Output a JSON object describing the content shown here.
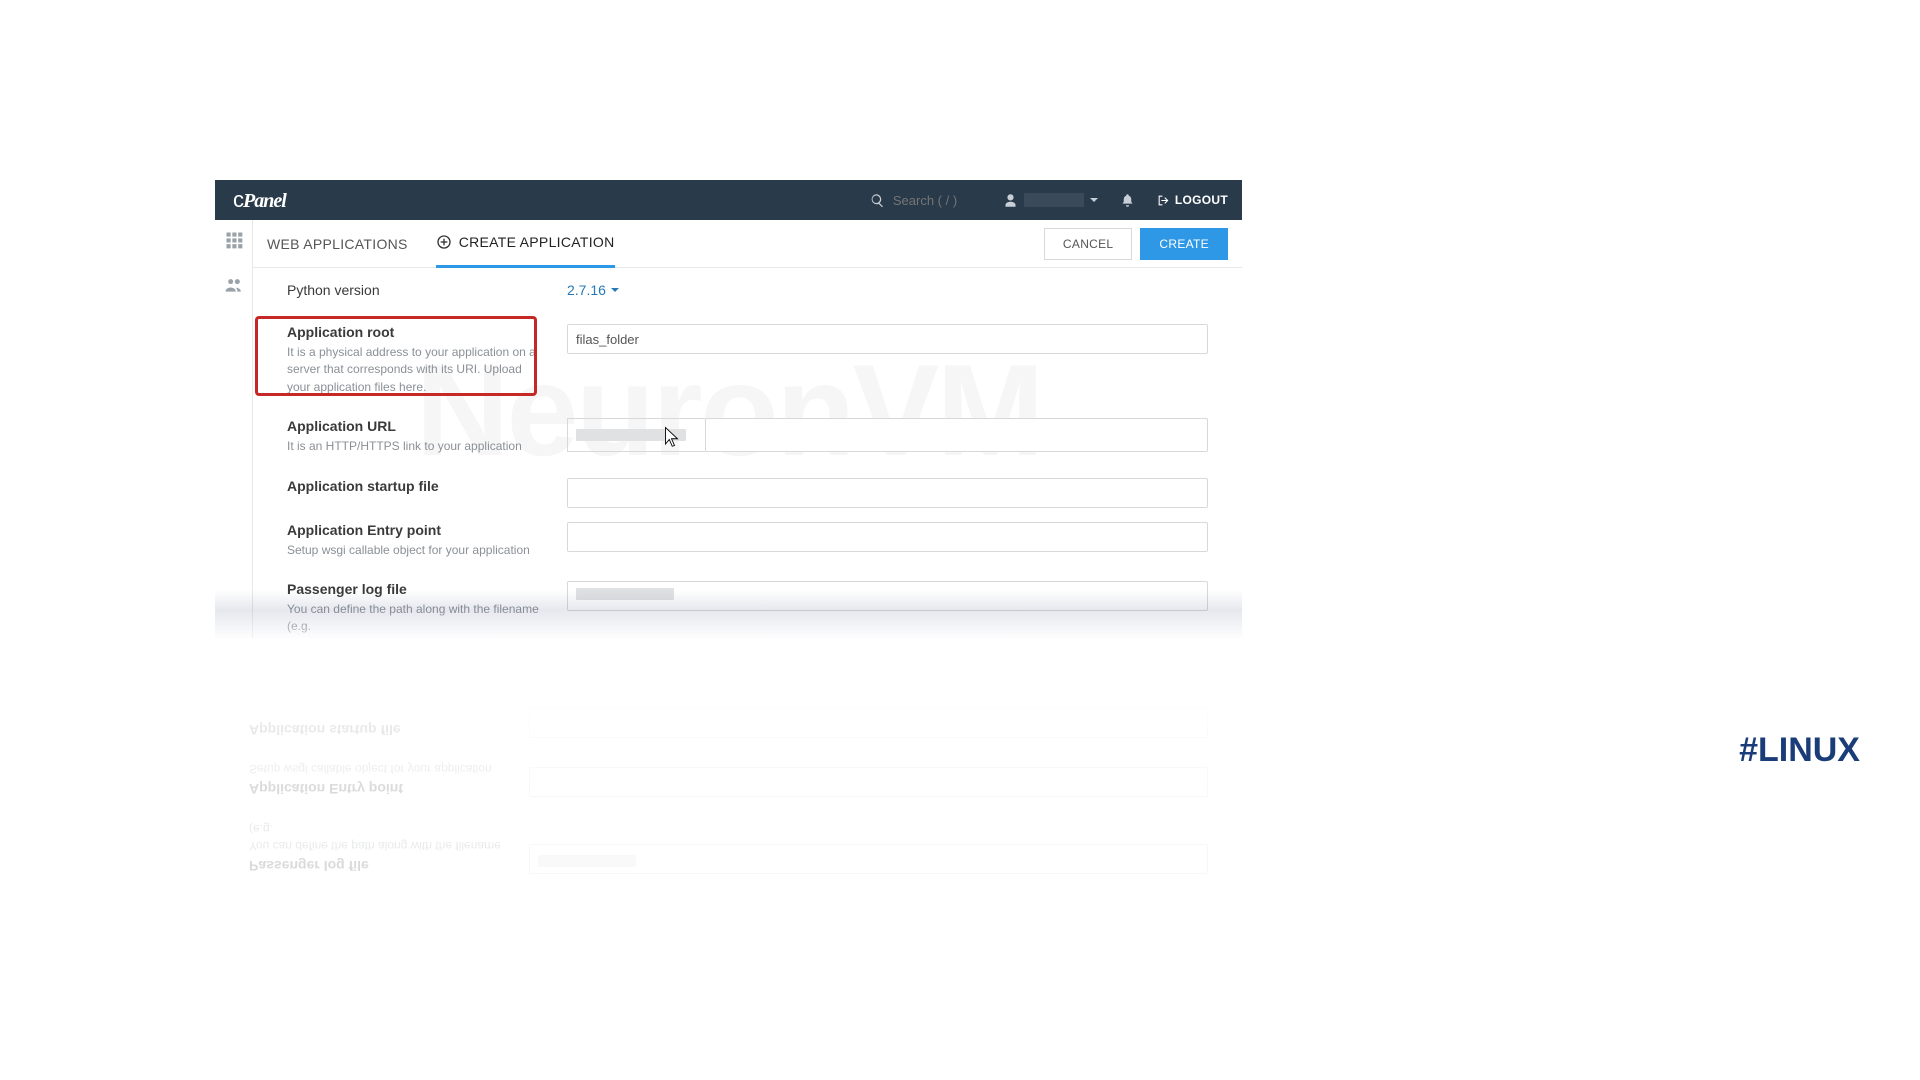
{
  "brand": "cPanel",
  "topbar": {
    "search_placeholder": "Search ( / )",
    "logout_label": "LOGOUT"
  },
  "tabs": {
    "web_apps": "WEB APPLICATIONS",
    "create_app": "CREATE APPLICATION"
  },
  "actions": {
    "cancel": "CANCEL",
    "create": "CREATE"
  },
  "form": {
    "python_version": {
      "label": "Python version",
      "value": "2.7.16"
    },
    "app_root": {
      "label": "Application root",
      "desc": "It is a physical address to your application on a server that corresponds with its URI. Upload your application files here.",
      "value": "filas_folder"
    },
    "app_url": {
      "label": "Application URL",
      "desc": "It is an HTTP/HTTPS link to your application"
    },
    "startup": {
      "label": "Application startup file"
    },
    "entry": {
      "label": "Application Entry point",
      "desc": "Setup wsgi callable object for your application"
    },
    "logfile": {
      "label": "Passenger log file",
      "desc": "You can define the path along with the filename (e.g."
    }
  },
  "watermark": "NeuronVM",
  "hashtag": "#LINUX"
}
